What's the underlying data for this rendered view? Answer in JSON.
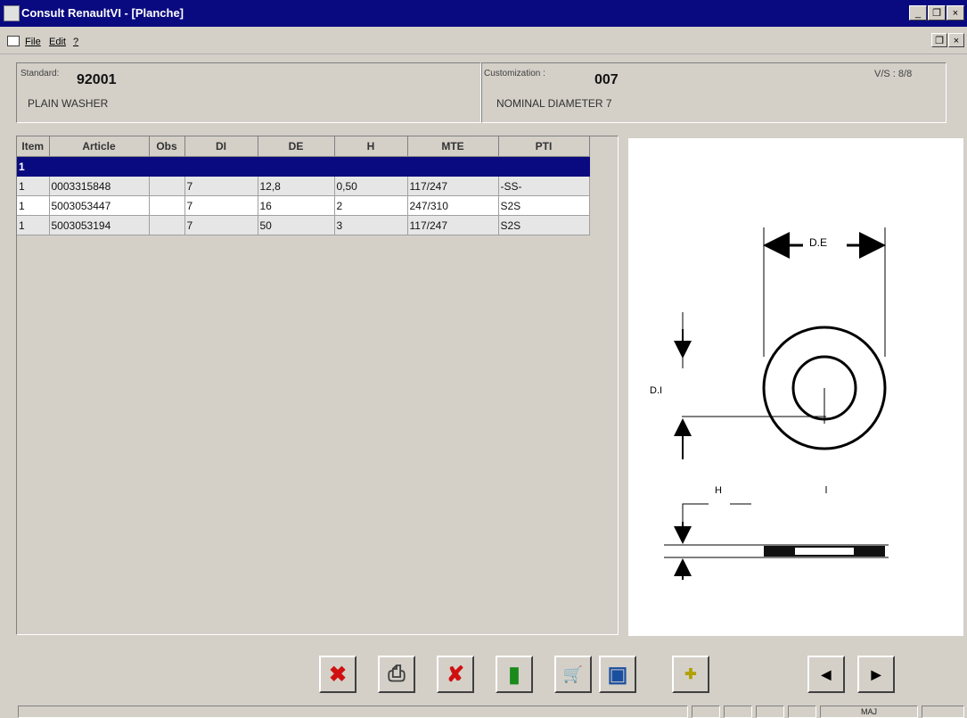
{
  "window": {
    "title": "Consult RenaultVI - [Planche]",
    "controls": {
      "minimize": "_",
      "restore": "❐",
      "close": "×"
    },
    "mdi_controls": {
      "restore": "❐",
      "close": "×"
    }
  },
  "menu": {
    "items": [
      "File",
      "Edit",
      "?"
    ]
  },
  "header": {
    "standard_label": "Standard:",
    "standard_value": "92001",
    "standard_desc": "PLAIN WASHER",
    "customization_label": "Customization :",
    "customization_value": "007",
    "customization_desc": "NOMINAL DIAMETER 7",
    "version": "V/S : 8/8"
  },
  "grid": {
    "columns": [
      "Item",
      "Article",
      "Obs",
      "DI",
      "DE",
      "H",
      "MTE",
      "PTI"
    ],
    "selected_row": [
      "1",
      "",
      "",
      "",
      "",
      "",
      "",
      ""
    ],
    "rows": [
      [
        "1",
        "0003315848",
        "",
        "7",
        "12,8",
        "0,50",
        "117/247",
        "-SS-"
      ],
      [
        "1",
        "5003053447",
        "",
        "7",
        "16",
        "2",
        "247/310",
        "S2S"
      ],
      [
        "1",
        "5003053194",
        "",
        "7",
        "50",
        "3",
        "117/247",
        "S2S"
      ]
    ]
  },
  "drawing": {
    "label_de": "D.E",
    "label_di": "D.I",
    "label_h": "H"
  },
  "toolbar": {
    "buttons": [
      {
        "name": "cancel-x-button",
        "icon": "red-cross-icon",
        "glyph": "✖",
        "color": "#d01010"
      },
      {
        "name": "print-button",
        "icon": "printer-icon",
        "glyph": "⎙",
        "color": "#404040"
      },
      {
        "name": "delete-button",
        "icon": "red-x-icon",
        "glyph": "✘",
        "color": "#d01010"
      },
      {
        "name": "exit-button",
        "icon": "door-exit-icon",
        "glyph": "▮",
        "color": "#1a8a1a"
      },
      {
        "name": "cart-button",
        "icon": "cart-icon",
        "glyph": "🛒",
        "color": "#303030"
      },
      {
        "name": "display-button",
        "icon": "monitor-icon",
        "glyph": "▣",
        "color": "#1a4fa0"
      },
      {
        "name": "add-button",
        "icon": "plus-icon",
        "glyph": "✚",
        "color": "#b0a000"
      },
      {
        "name": "previous-button",
        "icon": "arrow-left-icon",
        "glyph": "◀",
        "color": "#000000"
      },
      {
        "name": "next-button",
        "icon": "arrow-right-icon",
        "glyph": "▶",
        "color": "#000000"
      }
    ]
  },
  "status": {
    "mode": "MAJ"
  }
}
